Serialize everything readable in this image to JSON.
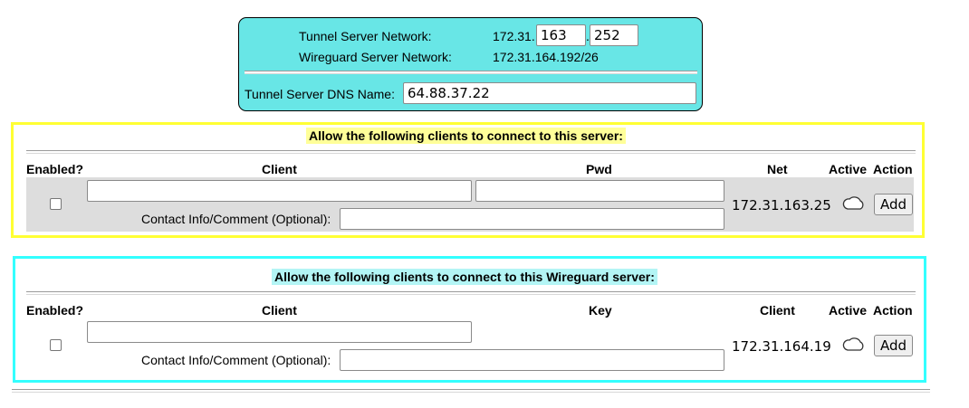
{
  "tunnel": {
    "network_label": "Tunnel Server Network:",
    "network_prefix": "172.31.",
    "octet3": "163",
    "dot": ".",
    "octet4": "252",
    "wg_network_label": "Wireguard Server Network:",
    "wg_network_value": "172.31.164.192/26",
    "dns_label": "Tunnel Server DNS Name:",
    "dns_value": "64.88.37.22"
  },
  "openvpn_clients": {
    "title": "Allow the following clients to connect to this server:",
    "title_bg": "#ffff99",
    "border_color": "#ffff33",
    "headers": {
      "enabled": "Enabled?",
      "client": "Client",
      "pwd": "Pwd",
      "net": "Net",
      "active": "Active",
      "action": "Action"
    },
    "row": {
      "client": "",
      "pwd": "",
      "comment_label": "Contact Info/Comment (Optional):",
      "comment": "",
      "net": "172.31.163.25",
      "active_icon": "cloud-icon",
      "action": "Add"
    }
  },
  "wireguard_clients": {
    "title": "Allow the following clients to connect to this Wireguard server:",
    "title_bg": "#b3f5f5",
    "border_color": "#33ffff",
    "headers": {
      "enabled": "Enabled?",
      "client": "Client",
      "key": "Key",
      "client_ip": "Client",
      "active": "Active",
      "action": "Action"
    },
    "row": {
      "client": "",
      "comment_label": "Contact Info/Comment (Optional):",
      "comment": "",
      "client_ip": "172.31.164.19",
      "active_icon": "cloud-icon",
      "action": "Add"
    }
  },
  "colors": {
    "tunnel_bg": "#68e6e6",
    "row_bg": "#dddddd"
  }
}
